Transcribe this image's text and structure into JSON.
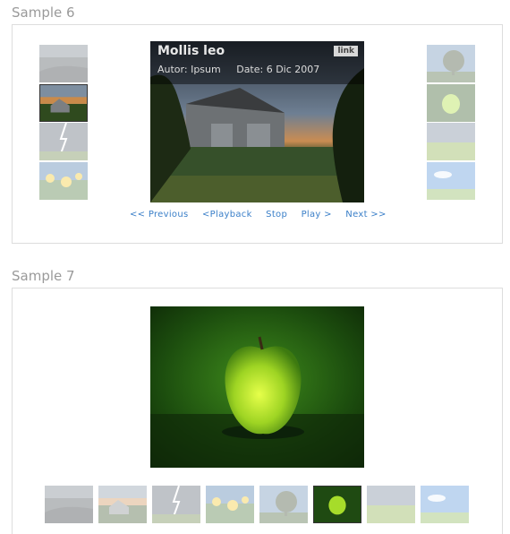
{
  "sample6": {
    "title": "Sample 6",
    "caption": {
      "title": "Mollis leo",
      "author": "Autor: Ipsum",
      "date": "Date: 6 Dic 2007",
      "link": "link"
    },
    "controls": {
      "previous": "<< Previous",
      "playback": "<Playback",
      "stop": "Stop",
      "play": "Play >",
      "next": "Next >>"
    },
    "left_thumbs": [
      "dark-water-scene",
      "barn-sunset",
      "lightning-storm",
      "yellow-flowers"
    ],
    "right_thumbs": [
      "tree-silhouette",
      "green-apple",
      "green-field",
      "blue-sky"
    ],
    "active_thumb": "barn-sunset"
  },
  "sample7": {
    "title": "Sample 7",
    "thumbs": [
      "dark-water-scene",
      "barn-sunset",
      "lightning-storm",
      "yellow-flowers",
      "tree-silhouette",
      "green-apple",
      "green-field",
      "blue-sky"
    ],
    "active_thumb": "green-apple"
  },
  "colors": {
    "link": "#3a7fc8",
    "section_title": "#9a9a9a",
    "border": "#dddddd"
  }
}
